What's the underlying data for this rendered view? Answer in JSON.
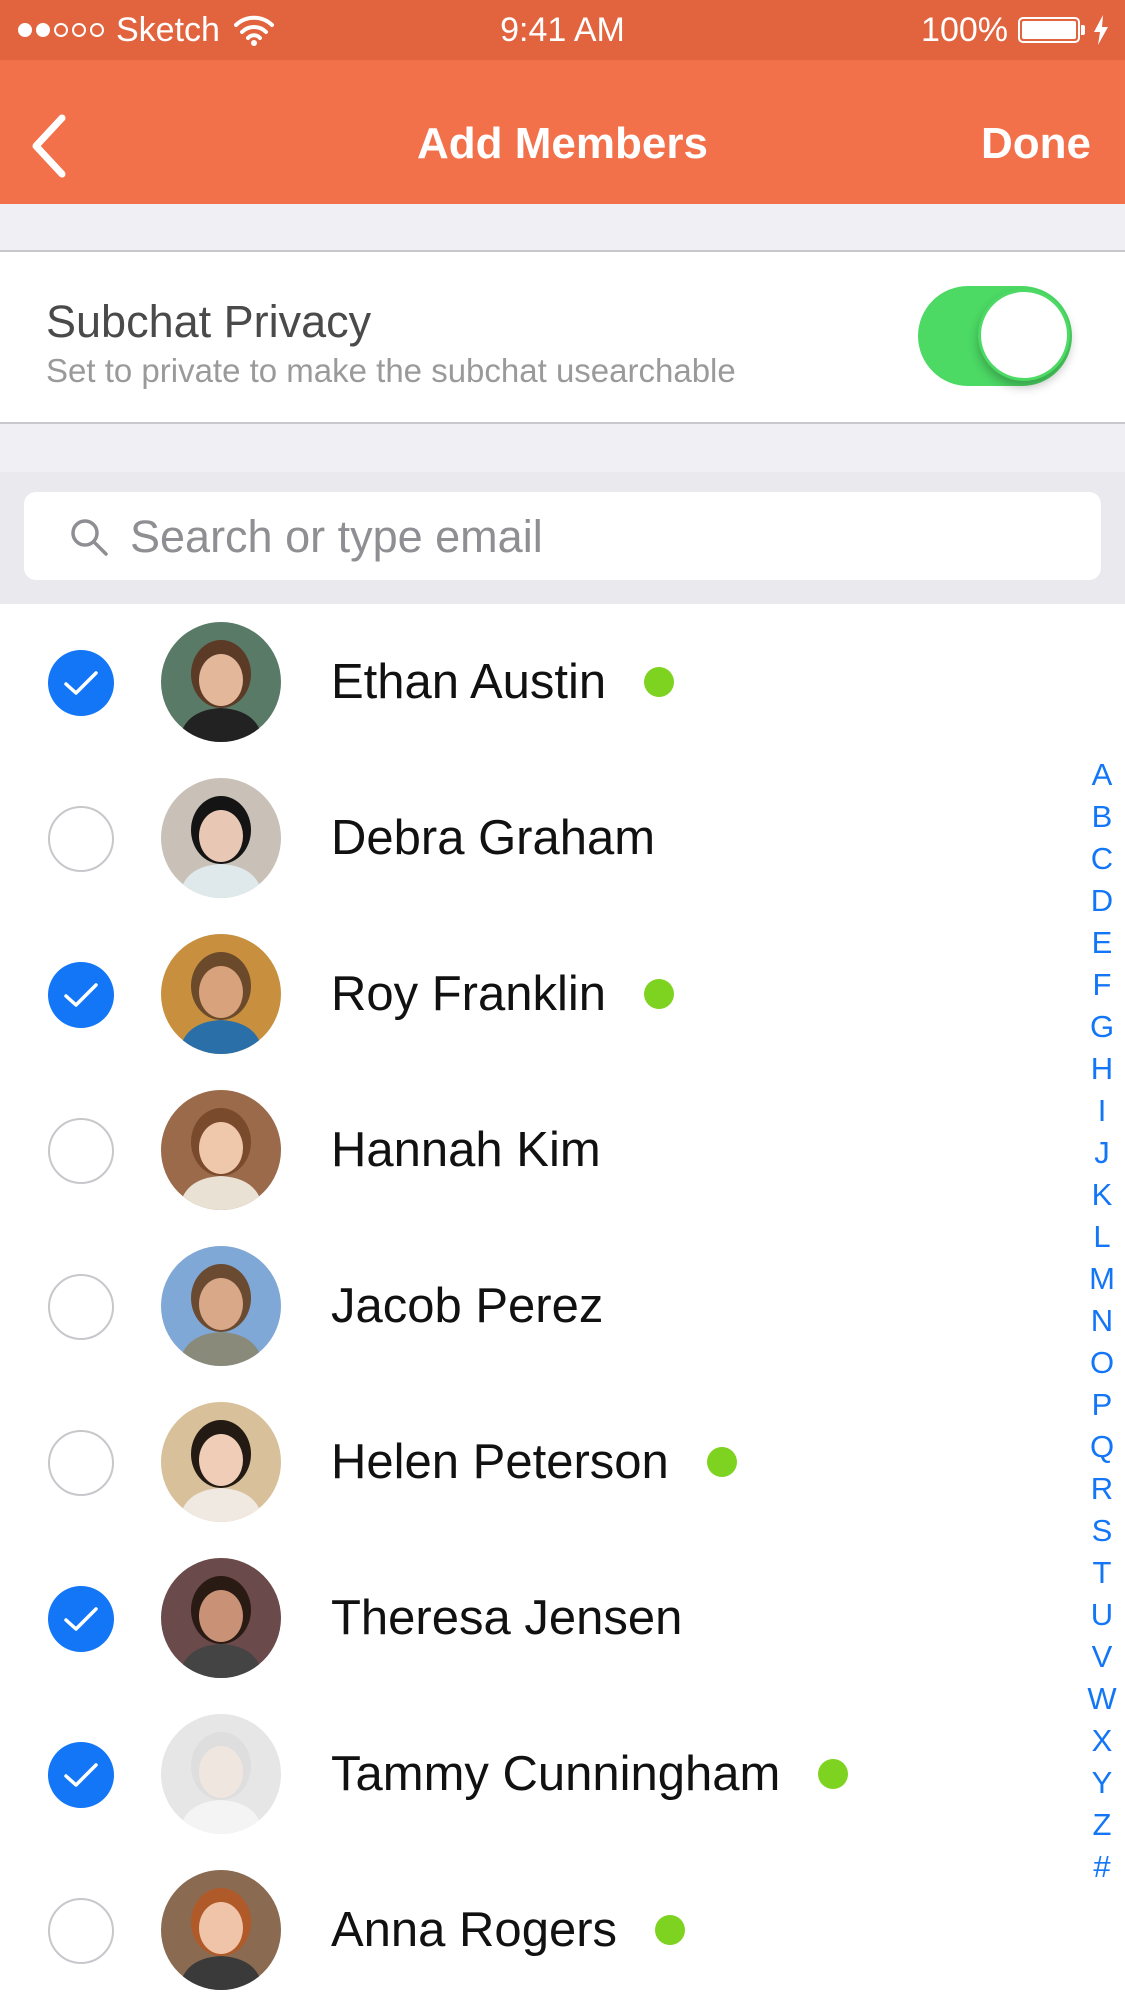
{
  "status_bar": {
    "signal_dots": [
      true,
      true,
      false,
      false,
      false
    ],
    "carrier": "Sketch",
    "time": "9:41 AM",
    "battery_percent": "100%"
  },
  "nav": {
    "back_icon": "chevron-left-icon",
    "title": "Add Members",
    "done_label": "Done"
  },
  "privacy": {
    "title": "Subchat Privacy",
    "subtitle": "Set to private to make the subchat usearchable",
    "toggle_on": true
  },
  "search": {
    "placeholder": "Search or type email",
    "value": ""
  },
  "contacts": [
    {
      "name": "Ethan Austin",
      "selected": true,
      "online": true
    },
    {
      "name": "Debra Graham",
      "selected": false,
      "online": false
    },
    {
      "name": "Roy Franklin",
      "selected": true,
      "online": true
    },
    {
      "name": "Hannah Kim",
      "selected": false,
      "online": false
    },
    {
      "name": "Jacob Perez",
      "selected": false,
      "online": false
    },
    {
      "name": "Helen Peterson",
      "selected": false,
      "online": true
    },
    {
      "name": "Theresa Jensen",
      "selected": true,
      "online": false
    },
    {
      "name": "Tammy Cunningham",
      "selected": true,
      "online": true
    },
    {
      "name": "Anna Rogers",
      "selected": false,
      "online": true
    }
  ],
  "index_letters": [
    "A",
    "B",
    "C",
    "D",
    "E",
    "F",
    "G",
    "H",
    "I",
    "J",
    "K",
    "L",
    "M",
    "N",
    "O",
    "P",
    "Q",
    "R",
    "S",
    "T",
    "U",
    "V",
    "W",
    "X",
    "Y",
    "Z",
    "#"
  ],
  "colors": {
    "nav_background": "#f2704a",
    "status_background": "#e2643f",
    "toggle_on": "#4cd964",
    "checkbox_selected": "#1376f7",
    "online_dot": "#7ed321",
    "index_text": "#1376f7"
  }
}
